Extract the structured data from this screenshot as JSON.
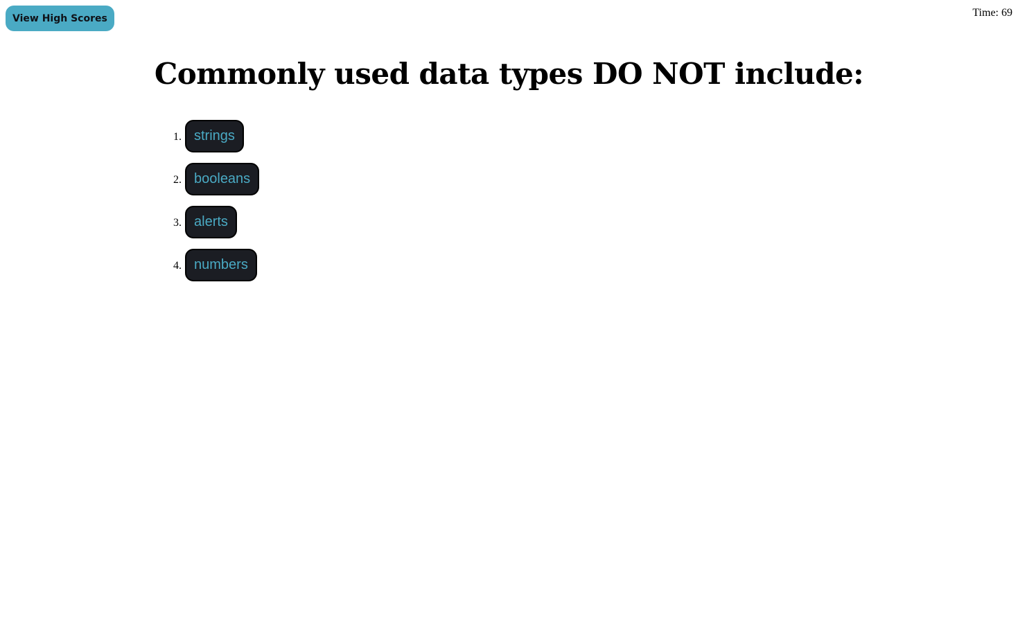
{
  "header": {
    "high_scores_label": "View High Scores",
    "timer_prefix": "Time:",
    "timer_value": "69"
  },
  "quiz": {
    "question": "Commonly used data types DO NOT include:",
    "choices": [
      {
        "number": "1.",
        "label": "strings"
      },
      {
        "number": "2.",
        "label": "booleans"
      },
      {
        "number": "3.",
        "label": "alerts"
      },
      {
        "number": "4.",
        "label": "numbers"
      }
    ]
  },
  "colors": {
    "accent": "#4aaac4",
    "choice_bg": "#1b1d23",
    "text": "#000000",
    "background": "#ffffff"
  }
}
